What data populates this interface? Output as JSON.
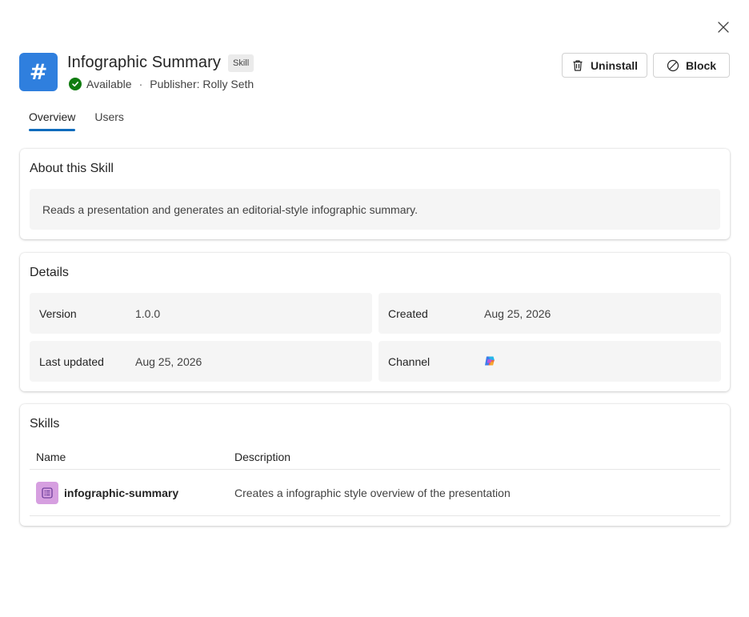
{
  "dialog": {
    "close_label": "Close"
  },
  "header": {
    "icon_glyph": "#",
    "icon_color": "#2f7fde",
    "title": "Infographic Summary",
    "type_badge": "Skill",
    "status": "Available",
    "status_color": "#107c10",
    "separator": "·",
    "publisher": "Publisher: Rolly Seth",
    "uninstall_label": "Uninstall",
    "block_label": "Block"
  },
  "tabs": [
    {
      "label": "Overview",
      "active": true
    },
    {
      "label": "Users",
      "active": false
    }
  ],
  "accent_color": "#0f6cbd",
  "about": {
    "title": "About this Skill",
    "description": "Reads a presentation and generates an editorial-style infographic summary."
  },
  "details": {
    "title": "Details",
    "version_label": "Version",
    "version_value": "1.0.0",
    "created_label": "Created",
    "created_value": "Aug 25, 2026",
    "updated_label": "Last updated",
    "updated_value": "Aug 25, 2026",
    "channel_label": "Channel",
    "channel_icon": "copilot-icon"
  },
  "skills": {
    "title": "Skills",
    "columns": [
      "Name",
      "Description"
    ],
    "rows": [
      {
        "name": "infographic-summary",
        "description": "Creates a infographic style overview of the presentation",
        "icon": "list-icon",
        "icon_color": "#d69fe0"
      }
    ]
  }
}
